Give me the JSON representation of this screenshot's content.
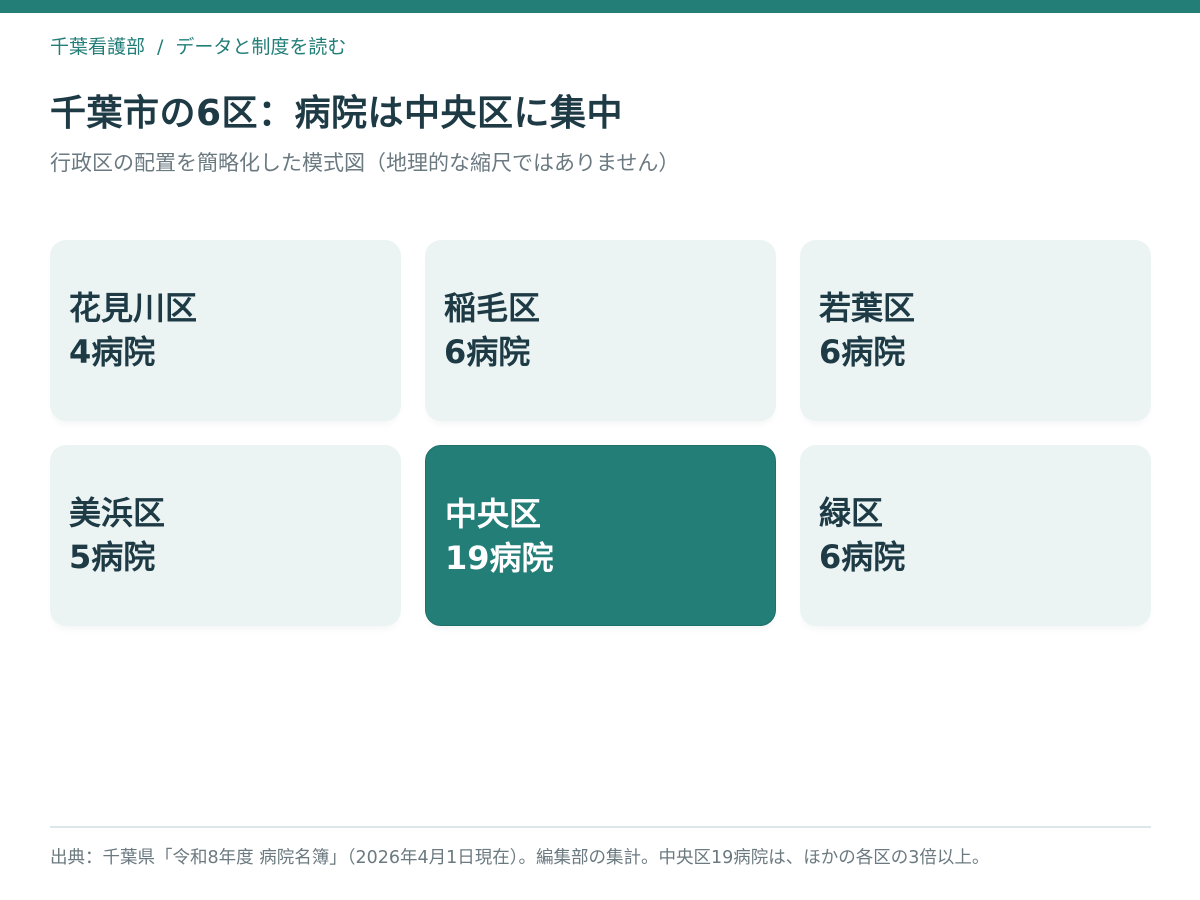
{
  "breadcrumb": {
    "site": "千葉看護部",
    "separator": "/",
    "section": "データと制度を読む"
  },
  "title": "千葉市の6区：病院は中央区に集中",
  "subtitle": "行政区の配置を簡略化した模式図（地理的な縮尺ではありません）",
  "wards": [
    {
      "name": "花見川区",
      "count": "4病院",
      "hospitals": 4,
      "highlighted": false
    },
    {
      "name": "稲毛区",
      "count": "6病院",
      "hospitals": 6,
      "highlighted": false
    },
    {
      "name": "若葉区",
      "count": "6病院",
      "hospitals": 6,
      "highlighted": false
    },
    {
      "name": "美浜区",
      "count": "5病院",
      "hospitals": 5,
      "highlighted": false
    },
    {
      "name": "中央区",
      "count": "19病院",
      "hospitals": 19,
      "highlighted": true
    },
    {
      "name": "緑区",
      "count": "6病院",
      "hospitals": 6,
      "highlighted": false
    }
  ],
  "footer": "出典：千葉県「令和8年度 病院名簿」（2026年4月1日現在）。編集部の集計。中央区19病院は、ほかの各区の3倍以上。",
  "colors": {
    "accent": "#237e78",
    "card_background": "#ebf4f3",
    "heading": "#1d3a45",
    "muted_text": "#6b7a80"
  }
}
